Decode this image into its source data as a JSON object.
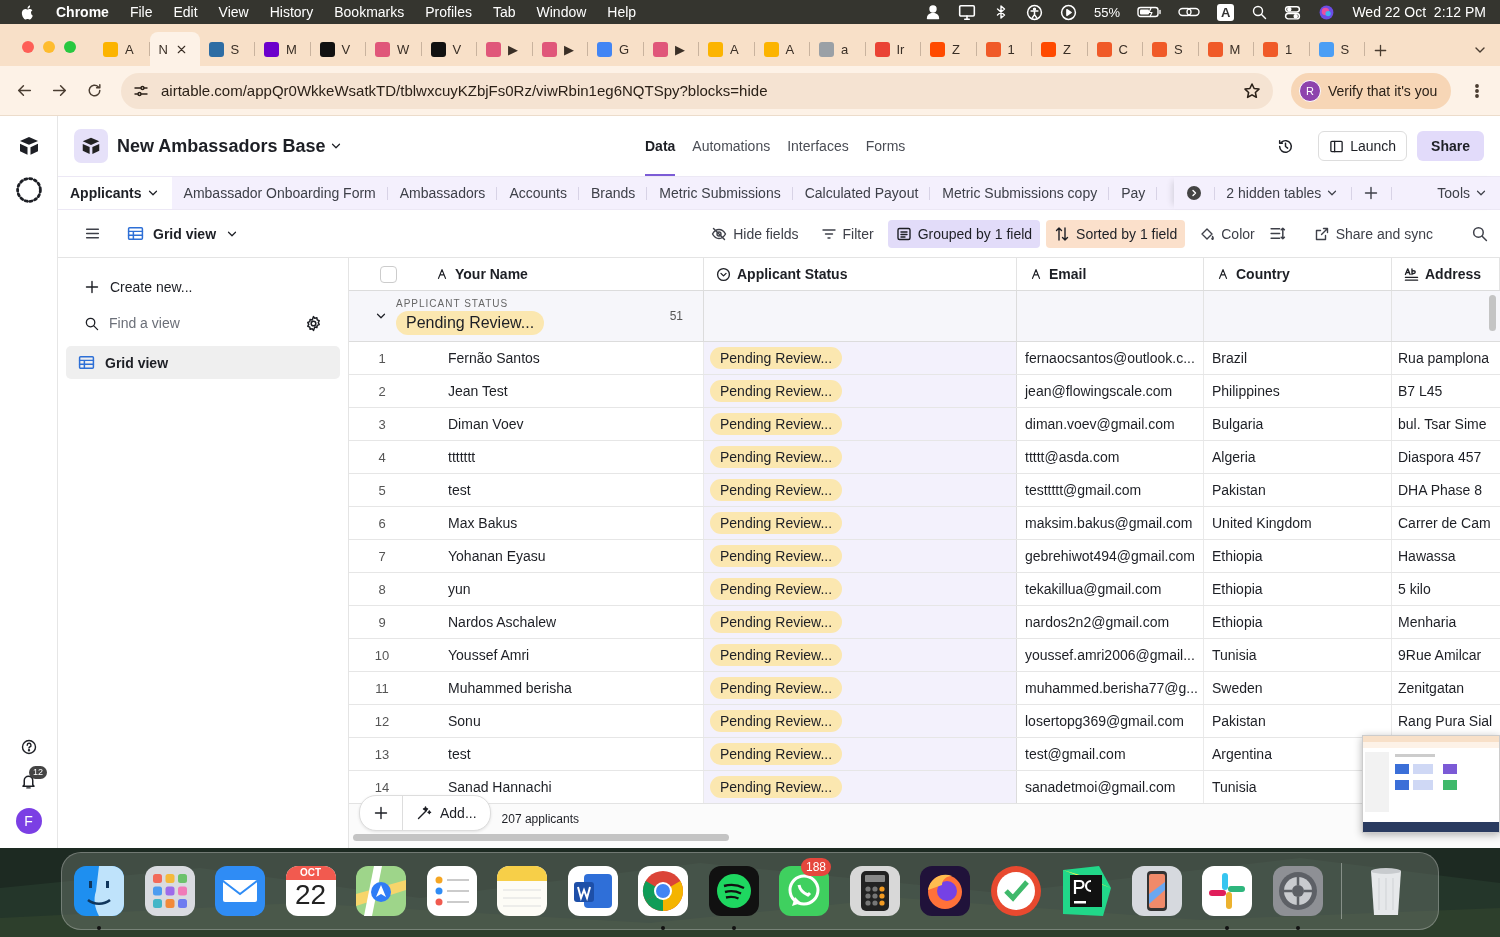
{
  "menubar": {
    "app": "Chrome",
    "menus": [
      "File",
      "Edit",
      "View",
      "History",
      "Bookmarks",
      "Profiles",
      "Tab",
      "Window",
      "Help"
    ],
    "battery": "55%",
    "input_source": "A",
    "clock": "Wed 22 Oct  2:12 PM"
  },
  "browser_tabs": [
    {
      "label": "A",
      "selected": false,
      "color": "#fcb400"
    },
    {
      "label": "N",
      "selected": true
    },
    {
      "label": "S",
      "selected": false,
      "color": "#2e6da4"
    },
    {
      "label": "M",
      "selected": false,
      "color": "#6d00cc"
    },
    {
      "label": "V",
      "selected": false,
      "color": "#111111"
    },
    {
      "label": "W",
      "selected": false,
      "color": "#e0577a"
    },
    {
      "label": "V",
      "selected": false,
      "color": "#111111"
    },
    {
      "label": "▶",
      "selected": false,
      "color": "#e0577a"
    },
    {
      "label": "▶",
      "selected": false,
      "color": "#e0577a"
    },
    {
      "label": "G",
      "selected": false,
      "color": "#4285f4"
    },
    {
      "label": "▶",
      "selected": false,
      "color": "#e0577a"
    },
    {
      "label": "A",
      "selected": false,
      "color": "#fcb400"
    },
    {
      "label": "A",
      "selected": false,
      "color": "#fcb400"
    },
    {
      "label": "a",
      "selected": false,
      "color": "#9aa0a6"
    },
    {
      "label": "Ir",
      "selected": false,
      "color": "#ea4335"
    },
    {
      "label": "Z",
      "selected": false,
      "color": "#ff4a00"
    },
    {
      "label": "1",
      "selected": false,
      "color": "#f05a28"
    },
    {
      "label": "Z",
      "selected": false,
      "color": "#ff4a00"
    },
    {
      "label": "C",
      "selected": false,
      "color": "#f05a28"
    },
    {
      "label": "S",
      "selected": false,
      "color": "#f05a28"
    },
    {
      "label": "M",
      "selected": false,
      "color": "#f05a28"
    },
    {
      "label": "1",
      "selected": false,
      "color": "#f05a28"
    },
    {
      "label": "S",
      "selected": false,
      "color": "#4b9ef5"
    }
  ],
  "address_bar": {
    "url": "airtable.com/appQr0WkkeWsatkTD/tblwxcuyKZbjFs0Rz/viwRbin1eg6NQTSpy?blocks=hide",
    "profile_initial": "R",
    "profile_button": "Verify that it's you"
  },
  "app_rail": {
    "notifications": "12",
    "avatar": "F"
  },
  "base": {
    "name": "New Ambassadors Base",
    "nav": [
      {
        "label": "Data",
        "selected": true
      },
      {
        "label": "Automations",
        "selected": false
      },
      {
        "label": "Interfaces",
        "selected": false
      },
      {
        "label": "Forms",
        "selected": false
      }
    ],
    "launch": "Launch",
    "share": "Share"
  },
  "table_tabs": [
    {
      "label": "Applicants",
      "selected": true
    },
    {
      "label": "Ambassador Onboarding Form",
      "selected": false
    },
    {
      "label": "Ambassadors",
      "selected": false
    },
    {
      "label": "Accounts",
      "selected": false
    },
    {
      "label": "Brands",
      "selected": false
    },
    {
      "label": "Metric Submissions",
      "selected": false
    },
    {
      "label": "Calculated Payout",
      "selected": false
    },
    {
      "label": "Metric Submissions copy",
      "selected": false
    },
    {
      "label": "Pay",
      "selected": false
    }
  ],
  "hidden_tables": "2 hidden tables",
  "tools": "Tools",
  "toolbar": {
    "view": "Grid view",
    "actions": [
      {
        "label": "Hide fields",
        "kind": "hide",
        "active": false
      },
      {
        "label": "Filter",
        "kind": "filter",
        "active": false
      },
      {
        "label": "Grouped by 1 field",
        "kind": "group",
        "active": true
      },
      {
        "label": "Sorted by 1 field",
        "kind": "sort",
        "active": true
      },
      {
        "label": "Color",
        "kind": "color",
        "active": false
      }
    ],
    "share_sync": "Share and sync"
  },
  "sidebar": {
    "create": "Create new...",
    "search_placeholder": "Find a view",
    "views": [
      {
        "label": "Grid view",
        "selected": true
      }
    ]
  },
  "grid": {
    "all_selected": false,
    "columns": [
      {
        "label": "Your Name",
        "kind": "text"
      },
      {
        "label": "Applicant Status",
        "kind": "select"
      },
      {
        "label": "Email",
        "kind": "text"
      },
      {
        "label": "Country",
        "kind": "text"
      },
      {
        "label": "Address",
        "kind": "longtext"
      }
    ],
    "group": {
      "field": "APPLICANT STATUS",
      "value": "Pending Review...",
      "count": "51",
      "expanded": true
    },
    "rows": [
      {
        "number": "1",
        "cells": [
          "Fernão Santos",
          "Pending Review...",
          "fernaocsantos@outlook.c...",
          "Brazil",
          "Rua pamplona"
        ]
      },
      {
        "number": "2",
        "cells": [
          "Jean Test",
          "Pending Review...",
          "jean@flowingscale.com",
          "Philippines",
          "B7 L45"
        ]
      },
      {
        "number": "3",
        "cells": [
          "Diman Voev",
          "Pending Review...",
          "diman.voev@gmail.com",
          "Bulgaria",
          "bul. Tsar Sime"
        ]
      },
      {
        "number": "4",
        "cells": [
          "ttttttt",
          "Pending Review...",
          "ttttt@asda.com",
          "Algeria",
          "Diaspora 457"
        ]
      },
      {
        "number": "5",
        "cells": [
          "test",
          "Pending Review...",
          "testtttt@gmail.com",
          "Pakistan",
          "DHA Phase 8"
        ]
      },
      {
        "number": "6",
        "cells": [
          "Max Bakus",
          "Pending Review...",
          "maksim.bakus@gmail.com",
          "United Kingdom",
          "Carrer de Cam"
        ]
      },
      {
        "number": "7",
        "cells": [
          "Yohanan Eyasu",
          "Pending Review...",
          "gebrehiwot494@gmail.com",
          "Ethiopia",
          "Hawassa"
        ]
      },
      {
        "number": "8",
        "cells": [
          "yun",
          "Pending Review...",
          "tekakillua@gmail.com",
          "Ethiopia",
          "5 kilo"
        ]
      },
      {
        "number": "9",
        "cells": [
          "Nardos Aschalew",
          "Pending Review...",
          "nardos2n2@gmail.com",
          "Ethiopia",
          "Menharia"
        ]
      },
      {
        "number": "10",
        "cells": [
          "Youssef Amri",
          "Pending Review...",
          "youssef.amri2006@gmail...",
          "Tunisia",
          "9Rue Amilcar"
        ]
      },
      {
        "number": "11",
        "cells": [
          "Muhammed berisha",
          "Pending Review...",
          "muhammed.berisha77@g...",
          "Sweden",
          "Zenitgatan"
        ]
      },
      {
        "number": "12",
        "cells": [
          "Sonu",
          "Pending Review...",
          "losertopg369@gmail.com",
          "Pakistan",
          "Rang Pura Sial"
        ]
      },
      {
        "number": "13",
        "cells": [
          "test",
          "Pending Review...",
          "test@gmail.com",
          "Argentina"
        ]
      },
      {
        "number": "14",
        "cells": [
          "Sanad Hannachi",
          "Pending Review...",
          "sanadetmoi@gmail.com",
          "Tunisia"
        ]
      }
    ],
    "footer": {
      "add": "Add...",
      "count": "207 applicants"
    }
  },
  "dock": [
    {
      "kind": "finder",
      "running": true
    },
    {
      "kind": "launchpad",
      "running": false
    },
    {
      "kind": "mail",
      "running": false
    },
    {
      "kind": "calendar",
      "running": false,
      "month": "OCT",
      "day": "22"
    },
    {
      "kind": "maps",
      "running": false
    },
    {
      "kind": "reminders",
      "running": false
    },
    {
      "kind": "notes",
      "running": false
    },
    {
      "kind": "word",
      "running": false
    },
    {
      "kind": "chrome",
      "running": true
    },
    {
      "kind": "spotify",
      "running": true
    },
    {
      "kind": "whatsapp",
      "running": false,
      "badge": "188"
    },
    {
      "kind": "calculator",
      "running": false
    },
    {
      "kind": "firefox",
      "running": false
    },
    {
      "kind": "checker",
      "running": false
    },
    {
      "kind": "pycharm",
      "running": false
    },
    {
      "kind": "phone",
      "running": false
    },
    {
      "kind": "slack",
      "running": true
    },
    {
      "kind": "settings",
      "running": true
    },
    {
      "kind": "trash",
      "running": false
    }
  ]
}
